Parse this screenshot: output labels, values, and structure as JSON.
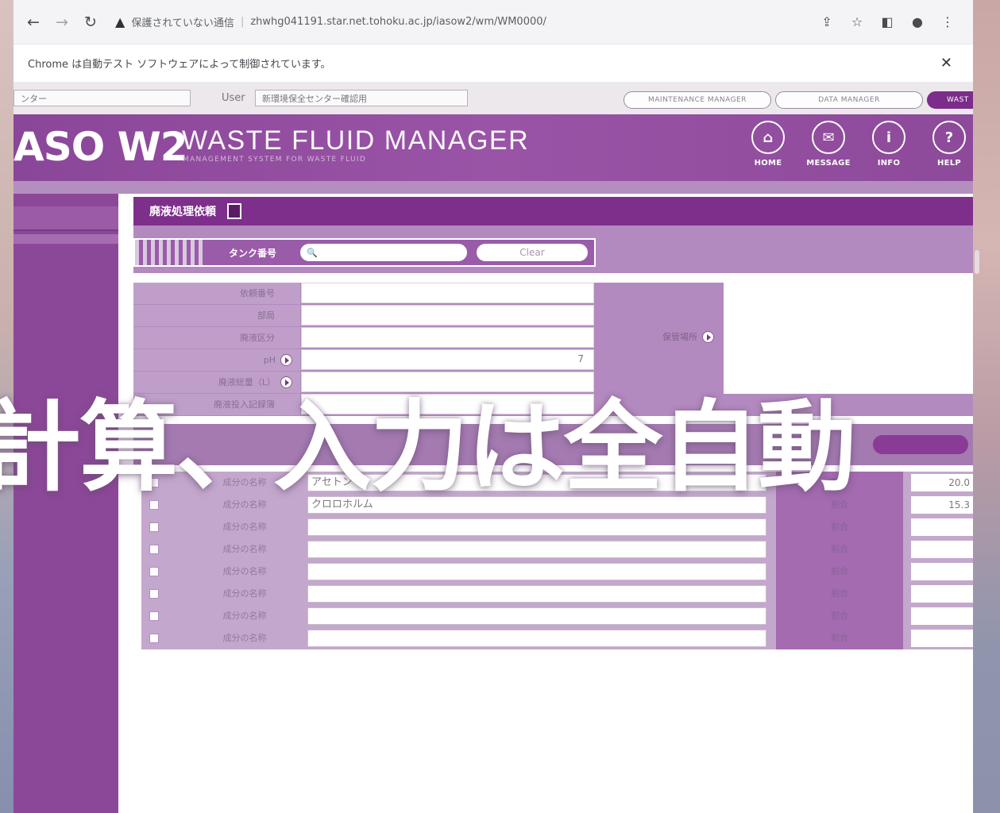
{
  "browser": {
    "warning_text": "保護されていない通信",
    "url": "zhwhg041191.star.net.tohoku.ac.jp/iasow2/wm/WM0000/",
    "infobar_message": "Chrome は自動テスト ソフトウェアによって制御されています。",
    "close_glyph": "✕"
  },
  "app": {
    "center_field": "ンター",
    "user_label": "User",
    "user_value": "新環境保全センター確認用",
    "mode_pills": [
      "MAINTENANCE MANAGER",
      "DATA MANAGER",
      "WAST"
    ],
    "logo": "ASO W2",
    "title": "WASTE FLUID MANAGER",
    "subtitle": "MANAGEMENT SYSTEM FOR WASTE FLUID",
    "nav": [
      {
        "label": "HOME",
        "icon": "⌂"
      },
      {
        "label": "MESSAGE",
        "icon": "✉"
      },
      {
        "label": "INFO",
        "icon": "i"
      },
      {
        "label": "HELP",
        "icon": "?"
      }
    ],
    "page_title": "廃液処理依頼",
    "search": {
      "label": "タンク番号",
      "icon": "🔍",
      "clear_label": "Clear"
    },
    "form_labels": [
      "依頼番号",
      "部局",
      "廃液区分",
      "pH",
      "廃液総量（L）",
      "廃液投入記録簿"
    ],
    "form_values": [
      "",
      "",
      "",
      "7",
      "",
      ""
    ],
    "storage_label": "保管場所",
    "components": [
      {
        "label": "成分の名称",
        "name": "アセトン",
        "ratio_label": "割合",
        "ratio": "20.0"
      },
      {
        "label": "成分の名称",
        "name": "クロロホルム",
        "ratio_label": "割合",
        "ratio": "15.3"
      },
      {
        "label": "成分の名称",
        "name": "",
        "ratio_label": "割合",
        "ratio": ""
      },
      {
        "label": "成分の名称",
        "name": "",
        "ratio_label": "割合",
        "ratio": ""
      },
      {
        "label": "成分の名称",
        "name": "",
        "ratio_label": "割合",
        "ratio": ""
      },
      {
        "label": "成分の名称",
        "name": "",
        "ratio_label": "割合",
        "ratio": ""
      },
      {
        "label": "成分の名称",
        "name": "",
        "ratio_label": "割合",
        "ratio": ""
      },
      {
        "label": "成分の名称",
        "name": "",
        "ratio_label": "割合",
        "ratio": ""
      }
    ]
  },
  "overlay_caption": "計算、入力は全自動",
  "colors": {
    "brand": "#8a4698",
    "header": "#7e2f8b",
    "panel": "#b38abf"
  }
}
